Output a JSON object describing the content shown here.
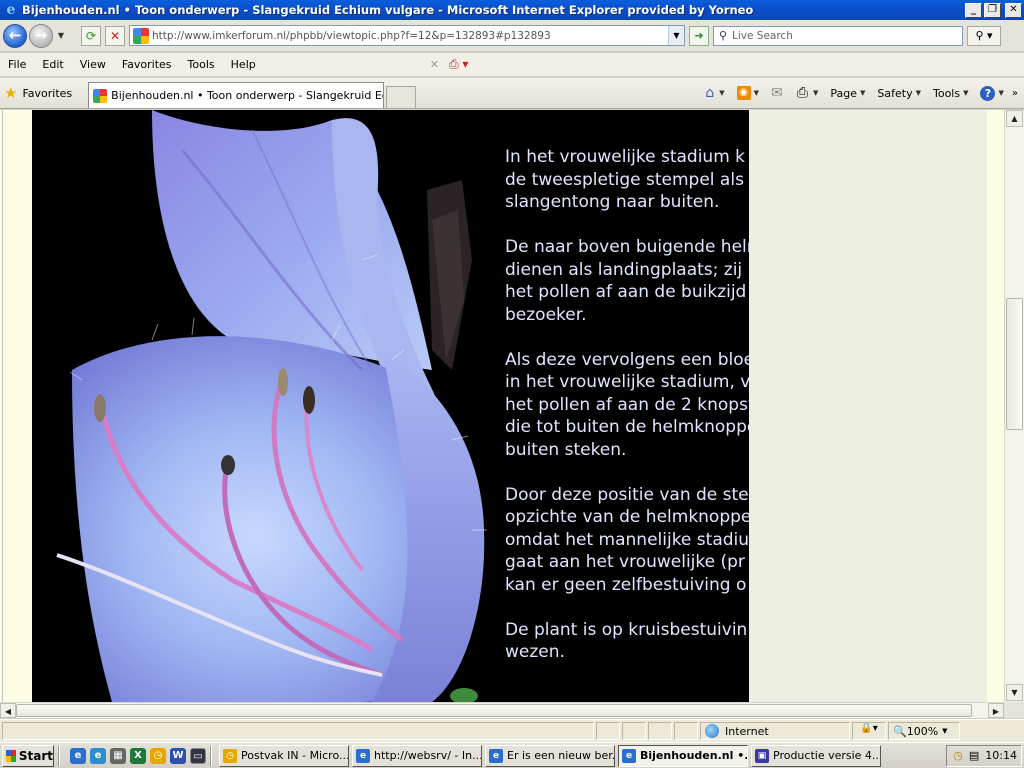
{
  "window": {
    "title": "Bijenhouden.nl • Toon onderwerp - Slangekruid Echium vulgare - Microsoft Internet Explorer provided by Yorneo",
    "buttons": {
      "minimize": "_",
      "restore": "❐",
      "close": "✕"
    }
  },
  "addressbar": {
    "url": "http://www.imkerforum.nl/phpbb/viewtopic.php?f=12&p=132893#p132893",
    "search_placeholder": "Live Search"
  },
  "menu": {
    "items": [
      "File",
      "Edit",
      "View",
      "Favorites",
      "Tools",
      "Help"
    ]
  },
  "tabs": {
    "favorites_label": "Favorites",
    "active_tab": "Bijenhouden.nl • Toon onderwerp - Slangekruid Echiu...",
    "commands": [
      "Page",
      "Safety",
      "Tools"
    ]
  },
  "content": {
    "paragraphs": [
      [
        "In het vrouwelijke stadium k",
        "de tweespletige stempel als",
        "slangentong naar buiten."
      ],
      [
        "De naar boven buigende helm",
        "dienen als landingplaats; zij",
        "het pollen af aan de buikzijd",
        "bezoeker."
      ],
      [
        "Als deze vervolgens een bloe",
        "in het vrouwelijke stadium, v",
        "het pollen af aan de 2 knopst",
        "die tot buiten de helmknoppe",
        "buiten steken."
      ],
      [
        "Door deze positie van de ste",
        "opzichte van de helmknoppen",
        "omdat het mannelijke stadiu",
        "gaat aan het vrouwelijke (pr",
        "kan er geen zelfbestuiving o"
      ],
      [
        "De plant is op kruisbestuivin",
        "wezen."
      ]
    ]
  },
  "statusbar": {
    "zone": "Internet",
    "zoom": "100%"
  },
  "taskbar": {
    "start": "Start",
    "tasks": [
      {
        "label": "Postvak IN - Micro...",
        "active": false
      },
      {
        "label": "http://websrv/ - In...",
        "active": false
      },
      {
        "label": "Er is een nieuw ber...",
        "active": false
      },
      {
        "label": "Bijenhouden.nl •...",
        "active": true
      },
      {
        "label": "Productie versie 4....",
        "active": false
      }
    ],
    "clock": "10:14"
  },
  "colors": {
    "titlebar": "#0b4cc4",
    "article_text": "#dfe6ff",
    "page_background": "#edf0e0"
  }
}
